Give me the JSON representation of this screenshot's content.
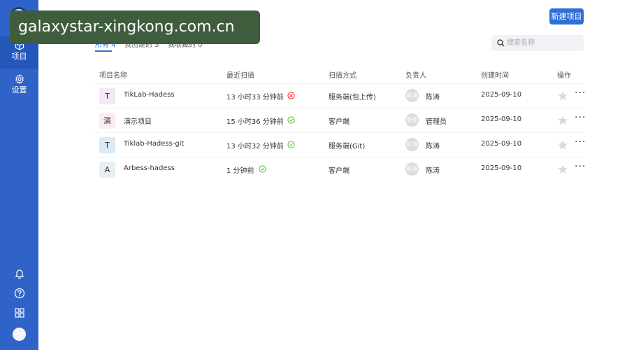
{
  "watermark": "galaxystar-xingkong.com.cn",
  "sidebar": {
    "items": [
      {
        "label": "项目",
        "icon": "cube-icon",
        "active": true
      },
      {
        "label": "设置",
        "icon": "gear-icon",
        "active": false
      }
    ],
    "bottom_icons": [
      "bell-icon",
      "help-icon",
      "apps-grid-icon"
    ]
  },
  "header": {
    "title": "项目",
    "new_button": "新建项目"
  },
  "tabs": [
    {
      "label": "所有 4",
      "active": true
    },
    {
      "label": "我创建的 3",
      "active": false
    },
    {
      "label": "我收藏的 0",
      "active": false
    }
  ],
  "search": {
    "placeholder": "搜索名称"
  },
  "table": {
    "headers": [
      "项目名称",
      "最近扫描",
      "扫描方式",
      "负责人",
      "创建时间",
      "操作"
    ],
    "rows": [
      {
        "initial": "T",
        "initial_bg": "#f3e8f5",
        "name": "TikLab-Hadess",
        "last_scan": "13 小时33 分钟前",
        "status": "error",
        "method": "服务端(包上传)",
        "avatar": "陈涛",
        "owner": "陈涛",
        "created": "2025-09-10"
      },
      {
        "initial": "演",
        "initial_bg": "#fbecef",
        "name": "演示项目",
        "last_scan": "15 小时36 分钟前",
        "status": "success",
        "method": "客户端",
        "avatar": "管理",
        "owner": "管理员",
        "created": "2025-09-10"
      },
      {
        "initial": "T",
        "initial_bg": "#dce9f8",
        "name": "Tiklab-Hadess-git",
        "last_scan": "13 小时32 分钟前",
        "status": "success",
        "method": "服务端(Git)",
        "avatar": "陈涛",
        "owner": "陈涛",
        "created": "2025-09-10"
      },
      {
        "initial": "A",
        "initial_bg": "#e6eff2",
        "name": "Arbess-hadess",
        "last_scan": "1 分钟前",
        "status": "success",
        "method": "客户端",
        "avatar": "陈涛",
        "owner": "陈涛",
        "created": "2025-09-10"
      }
    ]
  },
  "colors": {
    "sidebar": "#2f63c7",
    "accent": "#2f6fd6",
    "success": "#52c41a",
    "error": "#f5222d"
  }
}
